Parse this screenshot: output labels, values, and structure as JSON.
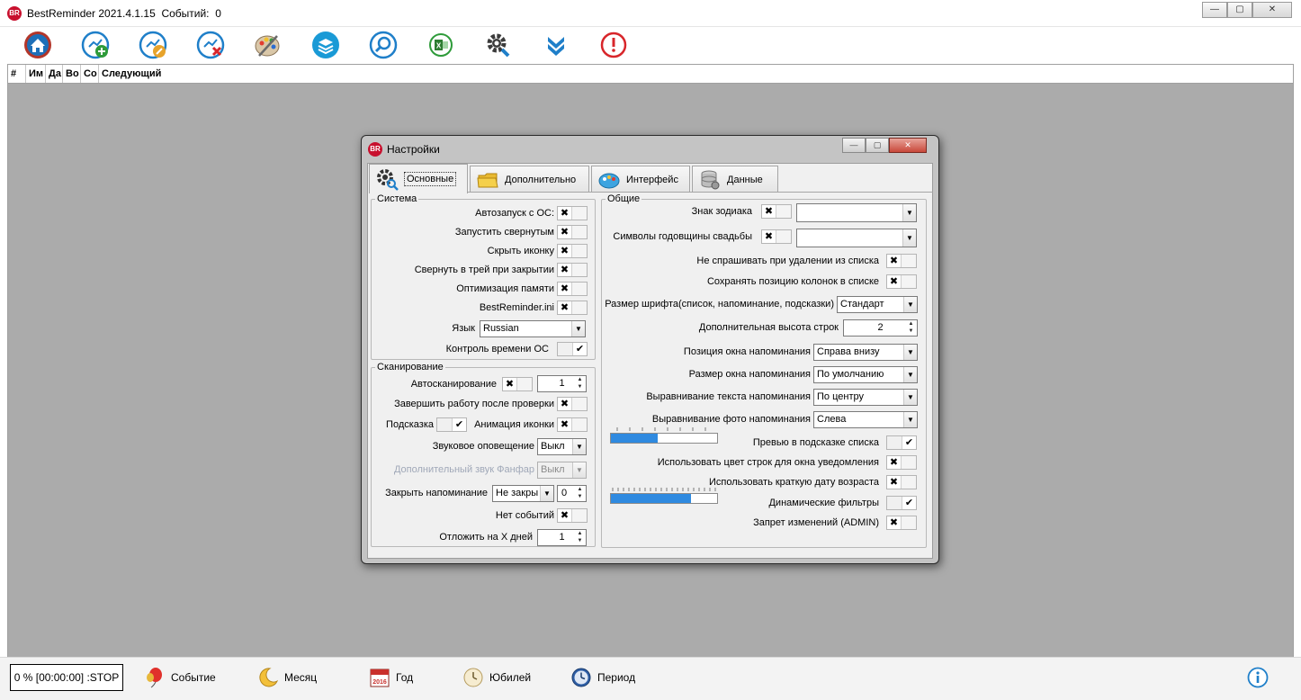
{
  "window": {
    "title": "BestReminder 2021.4.1.15",
    "events_label": "Событий:",
    "events_count": "0",
    "logo": "BR",
    "buttons": {
      "minimize": "—",
      "maximize": "▢",
      "close": "✕"
    }
  },
  "toolbar": [
    {
      "name": "home",
      "icon": "home-icon"
    },
    {
      "name": "add-event",
      "icon": "add-event-icon"
    },
    {
      "name": "edit-event",
      "icon": "edit-event-icon"
    },
    {
      "name": "delete-event",
      "icon": "delete-event-icon"
    },
    {
      "name": "palette",
      "icon": "palette-icon"
    },
    {
      "name": "layers",
      "icon": "layers-icon"
    },
    {
      "name": "search",
      "icon": "search-icon"
    },
    {
      "name": "excel",
      "icon": "excel-icon"
    },
    {
      "name": "settings",
      "icon": "gear-icon"
    },
    {
      "name": "expand",
      "icon": "chevron-double-down-icon"
    },
    {
      "name": "exit",
      "icon": "power-icon"
    }
  ],
  "columns": [
    "#",
    "Им",
    "Да",
    "Во",
    "Со",
    "Следующий"
  ],
  "statusbar": {
    "progress": "0 % [00:00:00] :STOP",
    "items": [
      {
        "label": "Событие",
        "icon": "balloon-icon"
      },
      {
        "label": "Месяц",
        "icon": "moon-icon"
      },
      {
        "label": "Год",
        "icon": "calendar-icon",
        "year": "2016"
      },
      {
        "label": "Юбилей",
        "icon": "clock-face-icon"
      },
      {
        "label": "Период",
        "icon": "clock-icon"
      }
    ],
    "info_icon": "info-icon"
  },
  "dialog": {
    "title": "Настройки",
    "logo": "BR",
    "buttons": {
      "minimize": "—",
      "maximize": "▢",
      "close": "✕"
    },
    "tabs": [
      {
        "label": "Основные",
        "icon": "gear-search-icon",
        "active": true
      },
      {
        "label": "Дополнительно",
        "icon": "folder-icon",
        "active": false
      },
      {
        "label": "Интерфейс",
        "icon": "palette-icon",
        "active": false
      },
      {
        "label": "Данные",
        "icon": "database-icon",
        "active": false
      }
    ],
    "system": {
      "legend": "Система",
      "autostart": "Автозапуск с ОС:",
      "start_minimized": "Запустить свернутым",
      "hide_icon": "Скрыть иконку",
      "minimize_tray": "Свернуть в трей при закрытии",
      "memory_opt": "Оптимизация памяти",
      "ini": "BestReminder.ini",
      "language_label": "Язык",
      "language_value": "Russian",
      "time_control": "Контроль времени ОС"
    },
    "scan": {
      "legend": "Сканирование",
      "autoscan": "Автосканирование",
      "autoscan_value": "1",
      "finish_after": "Завершить работу после проверки",
      "hint": "Подсказка",
      "icon_anim": "Анимация иконки",
      "sound": "Звуковое оповещение",
      "sound_value": "Выкл",
      "extra_sound": "Дополнительный звук Фанфар",
      "extra_sound_value": "Выкл",
      "close_reminder": "Закрыть напоминание",
      "close_reminder_value": "Не закры",
      "close_reminder_num": "0",
      "no_events": "Нет событий",
      "postpone": "Отложить на X дней",
      "postpone_value": "1"
    },
    "general": {
      "legend": "Общие",
      "zodiac": "Знак зодиака",
      "wedding": "Символы годовщины свадьбы",
      "no_ask_delete": "Не спрашивать при удалении из списка",
      "save_col_pos": "Сохранять позицию колонок в списке",
      "font_size": "Размер шрифта(список, напоминание, подсказки)",
      "font_size_value": "Стандарт",
      "row_height": "Дополнительная высота строк",
      "row_height_value": "2",
      "win_pos": "Позиция окна напоминания",
      "win_pos_value": "Справа внизу",
      "win_size": "Размер окна напоминания",
      "win_size_value": "По умолчанию",
      "text_align": "Выравнивание текста напоминания",
      "text_align_value": "По центру",
      "photo_align": "Выравнивание фото напоминания",
      "photo_align_value": "Слева",
      "preview": "Превью в подсказке списка",
      "row_colors": "Использовать цвет строк для окна уведомления",
      "short_date": "Использовать краткую дату возраста",
      "dyn_filters": "Динамические фильтры",
      "admin_lock": "Запрет изменений (ADMIN)",
      "slider1_level": 0.44,
      "slider2_level": 0.75
    },
    "mark_x": "✖",
    "mark_v": "✔",
    "combo_arrow": "▼",
    "spin_up": "▲",
    "spin_down": "▼"
  }
}
